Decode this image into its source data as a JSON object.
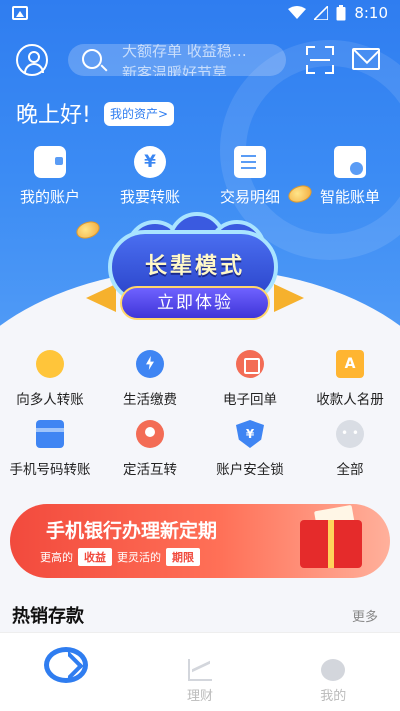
{
  "status_bar": {
    "time": "8:10"
  },
  "search": {
    "rotating_line_1": "大额存单 收益稳…",
    "rotating_line_2": "新客温暖好节莫"
  },
  "greeting": {
    "text": "晚上好!",
    "assets_button": "我的资产>"
  },
  "quick_actions": [
    {
      "label": "我的账户",
      "icon": "wallet-icon"
    },
    {
      "label": "我要转账",
      "icon": "yuan-transfer-icon"
    },
    {
      "label": "交易明细",
      "icon": "document-list-icon"
    },
    {
      "label": "智能账单",
      "icon": "bill-chart-icon"
    }
  ],
  "elder_mode": {
    "title": "长辈模式",
    "button": "立即体验"
  },
  "services": [
    {
      "label": "向多人转账",
      "icon": "multi-transfer-icon"
    },
    {
      "label": "生活缴费",
      "icon": "lightning-bill-icon"
    },
    {
      "label": "电子回单",
      "icon": "receipt-icon"
    },
    {
      "label": "收款人名册",
      "icon": "payee-book-icon"
    },
    {
      "label": "手机号码转账",
      "icon": "phone-card-icon"
    },
    {
      "label": "定活互转",
      "icon": "fixed-current-icon"
    },
    {
      "label": "账户安全锁",
      "icon": "shield-lock-icon"
    },
    {
      "label": "全部",
      "icon": "more-dots-icon"
    }
  ],
  "promo_banner": {
    "title": "手机银行办理新定期",
    "text_1": "更高的",
    "tag_1": "收益",
    "text_2": "更灵活的",
    "tag_2": "期限"
  },
  "section": {
    "title": "热销存款",
    "more": "更多"
  },
  "tab_bar": [
    {
      "label": "",
      "icon": "bank-logo-icon"
    },
    {
      "label": "理财",
      "icon": "finance-chart-icon"
    },
    {
      "label": "我的",
      "icon": "profile-face-icon"
    }
  ],
  "colors": {
    "primary": "#2f7df0",
    "promo_red": "#f24a3d",
    "elder_blue": "#3a5ae0"
  }
}
